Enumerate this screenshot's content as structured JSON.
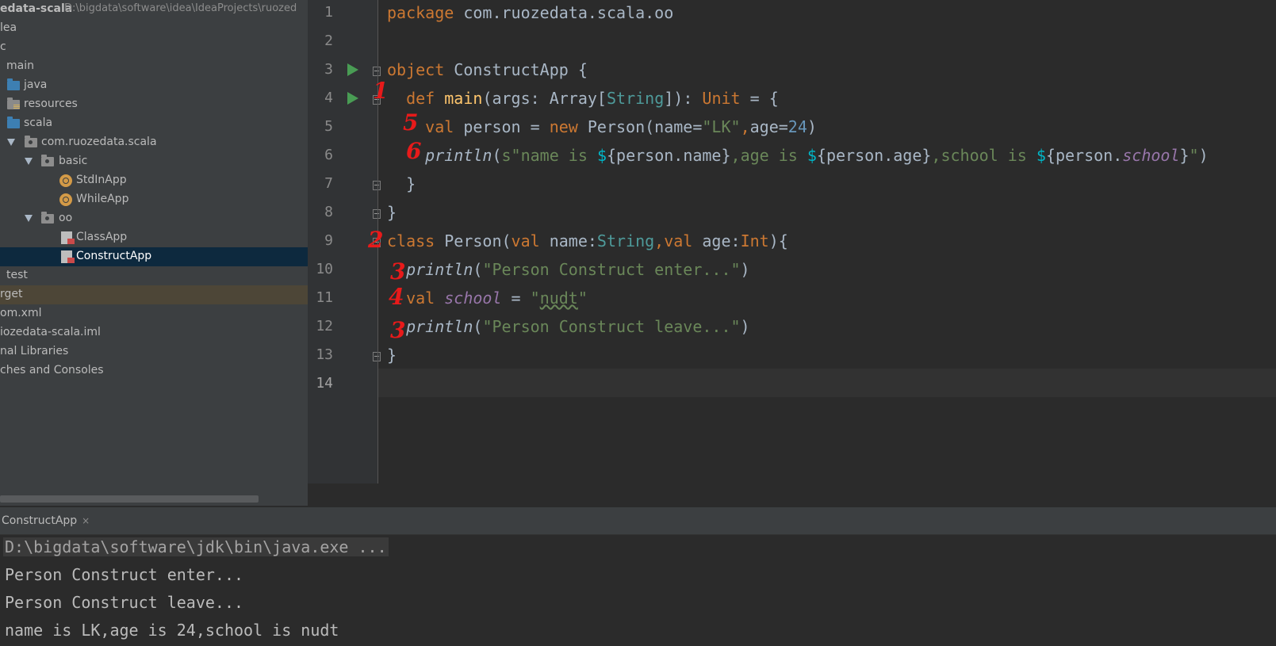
{
  "project": {
    "root_name": "edata-scala",
    "root_path": "D:\\bigdata\\software\\idea\\IdeaProjects\\ruozed",
    "items": [
      {
        "label": "lea"
      },
      {
        "label": "c"
      },
      {
        "label": "main"
      },
      {
        "label": "java"
      },
      {
        "label": "resources"
      },
      {
        "label": "scala"
      },
      {
        "label": "com.ruozedata.scala"
      },
      {
        "label": "basic"
      },
      {
        "label": "StdInApp"
      },
      {
        "label": "WhileApp"
      },
      {
        "label": "oo"
      },
      {
        "label": "ClassApp"
      },
      {
        "label": "ConstructApp"
      },
      {
        "label": "test"
      },
      {
        "label": "rget"
      },
      {
        "label": "om.xml"
      },
      {
        "label": "iozedata-scala.iml"
      },
      {
        "label": "nal Libraries"
      },
      {
        "label": "ches and Consoles"
      }
    ]
  },
  "editor": {
    "line_numbers": [
      "1",
      "2",
      "3",
      "4",
      "5",
      "6",
      "7",
      "8",
      "9",
      "10",
      "11",
      "12",
      "13",
      "14"
    ],
    "code": {
      "l1": {
        "kw": "package",
        "rest": " com.ruozedata.scala.oo"
      },
      "l3": {
        "kw": "object",
        "rest": " ConstructApp {"
      },
      "l4": {
        "indent": "  ",
        "kw": "def",
        "sp": " ",
        "fn": "main",
        "p1": "(args: Array[",
        "typ": "String",
        "p2": "]): ",
        "unit": "Unit",
        "p3": " = {"
      },
      "l5": {
        "indent": "    ",
        "kw": "val",
        "p1": " person = ",
        "kw2": "new",
        "p2": " Person(name=",
        "s1": "\"LK\"",
        "comma": ",",
        "p3": "age=",
        "n1": "24",
        "p4": ")"
      },
      "l6": {
        "indent": "    ",
        "fn": "println",
        "p0": "(",
        "s1": "s\"name is ",
        "d1": "$",
        "e1": "{person.name}",
        "s2": ",age is ",
        "d2": "$",
        "e2": "{person.age}",
        "s3": ",school is ",
        "d3": "$",
        "e3a": "{person.",
        "e3b": "school",
        "e3c": "}",
        "s4": "\"",
        "p5": ")"
      },
      "l7": {
        "text": "  }"
      },
      "l8": {
        "text": "}"
      },
      "l9": {
        "kw": "class",
        "p1": " Person(",
        "kw2": "val",
        "p2": " name:",
        "typ": "String",
        "comma": ",",
        "kw3": "val",
        "p3": " age:",
        "typ2": "Int",
        "p4": "){"
      },
      "l10": {
        "indent": "  ",
        "fn": "println",
        "p1": "(",
        "s1": "\"Person Construct enter...\"",
        "p2": ")"
      },
      "l11": {
        "indent": "  ",
        "kw": "val",
        "sp": " ",
        "field": "school",
        "p1": " = ",
        "q1": "\"",
        "s1": "nudt",
        "q2": "\""
      },
      "l12": {
        "indent": "  ",
        "fn": "println",
        "p1": "(",
        "s1": "\"Person Construct leave...\"",
        "p2": ")"
      },
      "l13": {
        "text": "}"
      }
    },
    "annotations": [
      "1",
      "5",
      "6",
      "2",
      "3",
      "4",
      "3"
    ]
  },
  "run": {
    "tab_label": "ConstructApp",
    "close_glyph": "×",
    "console": [
      "D:\\bigdata\\software\\jdk\\bin\\java.exe ...",
      "Person Construct enter...",
      "Person Construct leave...",
      "name is LK,age is 24,school is nudt"
    ]
  }
}
